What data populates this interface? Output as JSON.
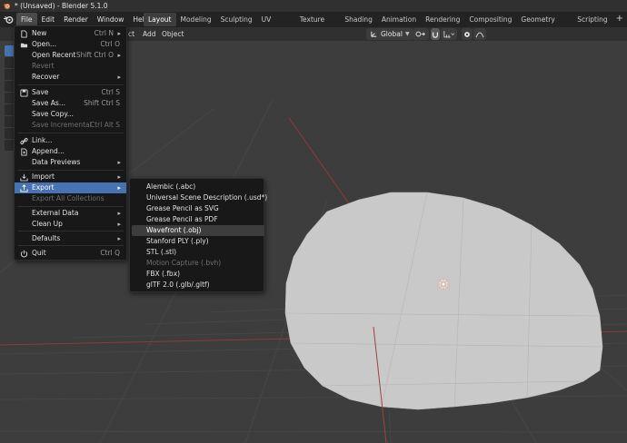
{
  "window": {
    "title": "* (Unsaved) - Blender 5.1.0"
  },
  "topbar": {
    "menus": [
      "File",
      "Edit",
      "Render",
      "Window",
      "Help"
    ],
    "workspaces": [
      "Layout",
      "Modeling",
      "Sculpting",
      "UV Editing",
      "Texture Paint",
      "Shading",
      "Animation",
      "Rendering",
      "Compositing",
      "Geometry Nodes",
      "Scripting"
    ],
    "active_workspace": "Layout",
    "add_tab": "+"
  },
  "viewport_header": {
    "partial_label": "ct",
    "add": "Add",
    "object": "Object",
    "orientation": "Global",
    "colors": {
      "accent": "#4772b3"
    }
  },
  "file_menu": {
    "items": [
      {
        "label": "New",
        "shortcut": "Ctrl N",
        "icon": "file-new-icon",
        "submenu": true
      },
      {
        "label": "Open...",
        "shortcut": "Ctrl O",
        "icon": "folder-open-icon"
      },
      {
        "label": "Open Recent",
        "shortcut": "Shift Ctrl O",
        "submenu": true
      },
      {
        "label": "Revert",
        "disabled": true
      },
      {
        "label": "Recover",
        "submenu": true
      },
      {
        "label": "Save",
        "shortcut": "Ctrl S",
        "icon": "save-icon"
      },
      {
        "label": "Save As...",
        "shortcut": "Shift Ctrl S"
      },
      {
        "label": "Save Copy..."
      },
      {
        "label": "Save Incremental",
        "shortcut": "Ctrl Alt S",
        "disabled": true
      },
      {
        "label": "Link...",
        "icon": "link-icon"
      },
      {
        "label": "Append...",
        "icon": "append-icon"
      },
      {
        "label": "Data Previews",
        "submenu": true
      },
      {
        "label": "Import",
        "icon": "import-icon",
        "submenu": true
      },
      {
        "label": "Export",
        "icon": "export-icon",
        "submenu": true,
        "highlighted": true
      },
      {
        "label": "Export All Collections",
        "disabled": true
      },
      {
        "label": "External Data",
        "submenu": true
      },
      {
        "label": "Clean Up",
        "submenu": true
      },
      {
        "label": "Defaults",
        "submenu": true
      },
      {
        "label": "Quit",
        "shortcut": "Ctrl Q",
        "icon": "quit-icon"
      }
    ]
  },
  "export_menu": {
    "items": [
      {
        "label": "Alembic (.abc)"
      },
      {
        "label": "Universal Scene Description (.usd*)"
      },
      {
        "label": "Grease Pencil as SVG"
      },
      {
        "label": "Grease Pencil as PDF"
      },
      {
        "label": "Wavefront (.obj)",
        "highlighted": true
      },
      {
        "label": "Stanford PLY (.ply)"
      },
      {
        "label": "STL (.stl)"
      },
      {
        "label": "Motion Capture (.bvh)",
        "disabled": true
      },
      {
        "label": "FBX (.fbx)"
      },
      {
        "label": "glTF 2.0 (.glb/.gltf)"
      }
    ]
  }
}
